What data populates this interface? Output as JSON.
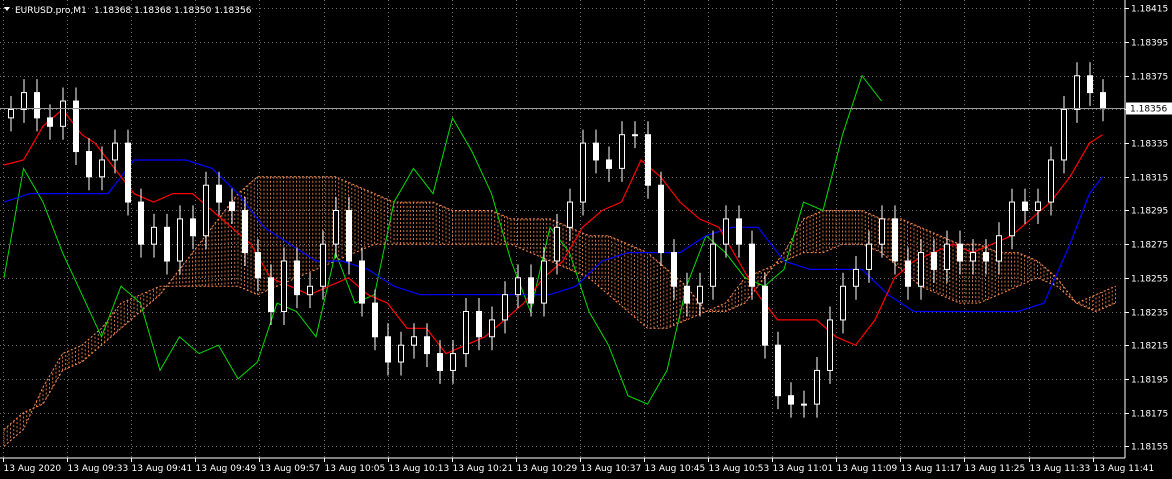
{
  "header": {
    "symbol": "EURUSD.pro,M1",
    "ohlc": "1.18368 1.18368 1.18350 1.18356"
  },
  "current_price_label": "1.18356",
  "colors": {
    "background": "#000000",
    "grid": "#c8c8c8",
    "candle_up": "#ffffff",
    "candle_down": "#ffffff",
    "wick": "#ffffff",
    "tenkan": "#ff0000",
    "kijun": "#0000ff",
    "chikou": "#00dd00",
    "cloud": "#ff8c50",
    "axis": "#ffffff",
    "price_line": "#9a9a9a"
  },
  "chart_data": {
    "type": "candlestick",
    "symbol": "EURUSD.pro",
    "timeframe": "M1",
    "ylim": [
      1.18148,
      1.1842
    ],
    "y_ticks": [
      "1.18415",
      "1.18395",
      "1.18375",
      "1.18355",
      "1.18335",
      "1.18315",
      "1.18295",
      "1.18275",
      "1.18255",
      "1.18235",
      "1.18215",
      "1.18195",
      "1.18175",
      "1.18155"
    ],
    "x_ticks": [
      "13 Aug 2020",
      "13 Aug 09:33",
      "13 Aug 09:41",
      "13 Aug 09:49",
      "13 Aug 09:57",
      "13 Aug 10:05",
      "13 Aug 10:13",
      "13 Aug 10:21",
      "13 Aug 10:29",
      "13 Aug 10:37",
      "13 Aug 10:45",
      "13 Aug 10:53",
      "13 Aug 11:01",
      "13 Aug 11:09",
      "13 Aug 11:17",
      "13 Aug 11:25",
      "13 Aug 11:33",
      "13 Aug 11:41"
    ],
    "close_points": [
      [
        1,
        1.18355
      ],
      [
        3,
        1.18365
      ],
      [
        5,
        1.1835
      ],
      [
        7,
        1.18345
      ],
      [
        9,
        1.1836
      ],
      [
        11,
        1.1833
      ],
      [
        13,
        1.18315
      ],
      [
        15,
        1.18325
      ],
      [
        17,
        1.18335
      ],
      [
        19,
        1.183
      ],
      [
        21,
        1.18275
      ],
      [
        23,
        1.18285
      ],
      [
        25,
        1.18265
      ],
      [
        27,
        1.1829
      ],
      [
        29,
        1.1828
      ],
      [
        31,
        1.1831
      ],
      [
        33,
        1.183
      ],
      [
        35,
        1.18295
      ],
      [
        37,
        1.1827
      ],
      [
        39,
        1.18255
      ],
      [
        41,
        1.18235
      ],
      [
        43,
        1.18265
      ],
      [
        45,
        1.18245
      ],
      [
        47,
        1.1825
      ],
      [
        49,
        1.18275
      ],
      [
        51,
        1.18295
      ],
      [
        53,
        1.18265
      ],
      [
        55,
        1.1824
      ],
      [
        57,
        1.1822
      ],
      [
        59,
        1.18205
      ],
      [
        61,
        1.18215
      ],
      [
        63,
        1.1822
      ],
      [
        65,
        1.1821
      ],
      [
        67,
        1.182
      ],
      [
        69,
        1.1821
      ],
      [
        71,
        1.18235
      ],
      [
        73,
        1.1822
      ],
      [
        75,
        1.1823
      ],
      [
        77,
        1.18245
      ],
      [
        79,
        1.18255
      ],
      [
        81,
        1.1824
      ],
      [
        83,
        1.18265
      ],
      [
        85,
        1.18285
      ],
      [
        87,
        1.183
      ],
      [
        89,
        1.18335
      ],
      [
        91,
        1.18325
      ],
      [
        93,
        1.1832
      ],
      [
        95,
        1.1834
      ],
      [
        97,
        1.1834
      ],
      [
        99,
        1.1831
      ],
      [
        101,
        1.1827
      ],
      [
        103,
        1.1825
      ],
      [
        105,
        1.1824
      ],
      [
        107,
        1.1825
      ],
      [
        109,
        1.18275
      ],
      [
        111,
        1.1829
      ],
      [
        113,
        1.18275
      ],
      [
        115,
        1.1825
      ],
      [
        117,
        1.18215
      ],
      [
        119,
        1.18185
      ],
      [
        121,
        1.1818
      ],
      [
        123,
        1.1818
      ],
      [
        125,
        1.182
      ],
      [
        127,
        1.1823
      ],
      [
        129,
        1.1825
      ],
      [
        131,
        1.1826
      ],
      [
        133,
        1.18275
      ],
      [
        135,
        1.1829
      ],
      [
        137,
        1.18265
      ],
      [
        139,
        1.1825
      ],
      [
        141,
        1.1827
      ],
      [
        143,
        1.1826
      ],
      [
        145,
        1.18275
      ],
      [
        147,
        1.18265
      ],
      [
        149,
        1.1827
      ],
      [
        151,
        1.18265
      ],
      [
        153,
        1.1828
      ],
      [
        155,
        1.183
      ],
      [
        157,
        1.18295
      ],
      [
        159,
        1.183
      ],
      [
        161,
        1.18325
      ],
      [
        163,
        1.18355
      ],
      [
        165,
        1.18375
      ],
      [
        167,
        1.18365
      ],
      [
        169,
        1.18356
      ]
    ],
    "series": [
      {
        "name": "tenkan_sen",
        "color": "#ff0000"
      },
      {
        "name": "kijun_sen",
        "color": "#0000ff"
      },
      {
        "name": "chikou_span",
        "color": "#00dd00"
      },
      {
        "name": "kumo_cloud",
        "color": "#ff8c50"
      }
    ],
    "tenkan": [
      [
        0,
        1.18322
      ],
      [
        3,
        1.18325
      ],
      [
        6,
        1.18345
      ],
      [
        9,
        1.18355
      ],
      [
        12,
        1.1834
      ],
      [
        14,
        1.18335
      ],
      [
        17,
        1.1832
      ],
      [
        20,
        1.18305
      ],
      [
        23,
        1.183
      ],
      [
        26,
        1.18305
      ],
      [
        29,
        1.18305
      ],
      [
        32,
        1.18295
      ],
      [
        35,
        1.18285
      ],
      [
        38,
        1.18275
      ],
      [
        41,
        1.18255
      ],
      [
        44,
        1.1825
      ],
      [
        47,
        1.18245
      ],
      [
        50,
        1.1825
      ],
      [
        53,
        1.18255
      ],
      [
        56,
        1.18245
      ],
      [
        59,
        1.1824
      ],
      [
        62,
        1.18225
      ],
      [
        65,
        1.18225
      ],
      [
        68,
        1.1821
      ],
      [
        71,
        1.18215
      ],
      [
        74,
        1.1822
      ],
      [
        77,
        1.1823
      ],
      [
        80,
        1.1824
      ],
      [
        83,
        1.18255
      ],
      [
        86,
        1.18265
      ],
      [
        89,
        1.18285
      ],
      [
        92,
        1.18295
      ],
      [
        95,
        1.183
      ],
      [
        98,
        1.18325
      ],
      [
        101,
        1.18315
      ],
      [
        104,
        1.183
      ],
      [
        107,
        1.1829
      ],
      [
        110,
        1.18285
      ],
      [
        113,
        1.18265
      ],
      [
        116,
        1.18245
      ],
      [
        119,
        1.1823
      ],
      [
        122,
        1.1823
      ],
      [
        125,
        1.1823
      ],
      [
        128,
        1.1822
      ],
      [
        131,
        1.18215
      ],
      [
        134,
        1.1823
      ],
      [
        137,
        1.18255
      ],
      [
        140,
        1.18265
      ],
      [
        143,
        1.1827
      ],
      [
        146,
        1.18275
      ],
      [
        149,
        1.1827
      ],
      [
        152,
        1.18275
      ],
      [
        155,
        1.1828
      ],
      [
        158,
        1.1829
      ],
      [
        161,
        1.183
      ],
      [
        164,
        1.18315
      ],
      [
        167,
        1.18335
      ],
      [
        169,
        1.1834
      ]
    ],
    "kijun": [
      [
        0,
        1.183
      ],
      [
        4,
        1.18305
      ],
      [
        8,
        1.18305
      ],
      [
        12,
        1.18305
      ],
      [
        16,
        1.18305
      ],
      [
        20,
        1.18325
      ],
      [
        24,
        1.18325
      ],
      [
        28,
        1.18325
      ],
      [
        32,
        1.1832
      ],
      [
        36,
        1.18305
      ],
      [
        40,
        1.18285
      ],
      [
        44,
        1.18275
      ],
      [
        48,
        1.18265
      ],
      [
        52,
        1.18265
      ],
      [
        56,
        1.1826
      ],
      [
        60,
        1.1825
      ],
      [
        64,
        1.18245
      ],
      [
        68,
        1.18245
      ],
      [
        72,
        1.18245
      ],
      [
        76,
        1.18245
      ],
      [
        80,
        1.18245
      ],
      [
        84,
        1.18245
      ],
      [
        88,
        1.1825
      ],
      [
        92,
        1.18265
      ],
      [
        96,
        1.1827
      ],
      [
        100,
        1.1827
      ],
      [
        104,
        1.1827
      ],
      [
        108,
        1.1828
      ],
      [
        112,
        1.18285
      ],
      [
        116,
        1.18285
      ],
      [
        120,
        1.18265
      ],
      [
        124,
        1.1826
      ],
      [
        128,
        1.1826
      ],
      [
        132,
        1.1826
      ],
      [
        136,
        1.18245
      ],
      [
        140,
        1.18235
      ],
      [
        144,
        1.18235
      ],
      [
        148,
        1.18235
      ],
      [
        152,
        1.18235
      ],
      [
        156,
        1.18235
      ],
      [
        160,
        1.1824
      ],
      [
        164,
        1.18275
      ],
      [
        167,
        1.18305
      ],
      [
        169,
        1.18315
      ]
    ],
    "chikou": [
      [
        0,
        1.18255
      ],
      [
        3,
        1.1832
      ],
      [
        6,
        1.183
      ],
      [
        9,
        1.1827
      ],
      [
        12,
        1.18245
      ],
      [
        15,
        1.1822
      ],
      [
        18,
        1.1825
      ],
      [
        21,
        1.1824
      ],
      [
        24,
        1.182
      ],
      [
        27,
        1.1822
      ],
      [
        30,
        1.1821
      ],
      [
        33,
        1.18215
      ],
      [
        36,
        1.18195
      ],
      [
        39,
        1.18205
      ],
      [
        42,
        1.1824
      ],
      [
        45,
        1.18235
      ],
      [
        48,
        1.1822
      ],
      [
        51,
        1.1827
      ],
      [
        54,
        1.1824
      ],
      [
        57,
        1.18245
      ],
      [
        60,
        1.183
      ],
      [
        63,
        1.1832
      ],
      [
        66,
        1.18305
      ],
      [
        69,
        1.1835
      ],
      [
        72,
        1.1833
      ],
      [
        75,
        1.18305
      ],
      [
        78,
        1.18265
      ],
      [
        81,
        1.18235
      ],
      [
        84,
        1.18285
      ],
      [
        87,
        1.1827
      ],
      [
        90,
        1.18235
      ],
      [
        93,
        1.18215
      ],
      [
        96,
        1.18185
      ],
      [
        99,
        1.1818
      ],
      [
        102,
        1.182
      ],
      [
        105,
        1.1825
      ],
      [
        108,
        1.1828
      ],
      [
        111,
        1.1827
      ],
      [
        114,
        1.18255
      ],
      [
        117,
        1.1825
      ],
      [
        120,
        1.1826
      ],
      [
        123,
        1.183
      ],
      [
        126,
        1.18295
      ],
      [
        129,
        1.1834
      ],
      [
        132,
        1.18375
      ],
      [
        135,
        1.1836
      ]
    ],
    "senkou_a": [
      [
        0,
        1.18165
      ],
      [
        3,
        1.18175
      ],
      [
        6,
        1.1818
      ],
      [
        9,
        1.182
      ],
      [
        12,
        1.18205
      ],
      [
        15,
        1.18215
      ],
      [
        18,
        1.18225
      ],
      [
        21,
        1.18235
      ],
      [
        24,
        1.18245
      ],
      [
        27,
        1.1826
      ],
      [
        30,
        1.18275
      ],
      [
        33,
        1.1829
      ],
      [
        36,
        1.18305
      ],
      [
        39,
        1.18315
      ],
      [
        42,
        1.18315
      ],
      [
        45,
        1.18315
      ],
      [
        48,
        1.18315
      ],
      [
        51,
        1.18315
      ],
      [
        54,
        1.1831
      ],
      [
        57,
        1.18305
      ],
      [
        60,
        1.183
      ],
      [
        63,
        1.183
      ],
      [
        66,
        1.183
      ],
      [
        69,
        1.18295
      ],
      [
        72,
        1.18295
      ],
      [
        75,
        1.18295
      ],
      [
        78,
        1.1829
      ],
      [
        81,
        1.1829
      ],
      [
        84,
        1.1829
      ],
      [
        87,
        1.18285
      ],
      [
        90,
        1.1828
      ],
      [
        93,
        1.1828
      ],
      [
        96,
        1.18275
      ],
      [
        99,
        1.1827
      ],
      [
        102,
        1.1826
      ],
      [
        105,
        1.1825
      ],
      [
        108,
        1.18235
      ],
      [
        111,
        1.18235
      ],
      [
        114,
        1.1824
      ],
      [
        117,
        1.18255
      ],
      [
        120,
        1.1827
      ],
      [
        123,
        1.1829
      ],
      [
        126,
        1.18295
      ],
      [
        129,
        1.18295
      ],
      [
        132,
        1.18295
      ],
      [
        135,
        1.1829
      ],
      [
        138,
        1.1829
      ],
      [
        141,
        1.18285
      ],
      [
        144,
        1.1828
      ],
      [
        147,
        1.18275
      ],
      [
        150,
        1.18275
      ],
      [
        153,
        1.1827
      ],
      [
        156,
        1.1827
      ],
      [
        159,
        1.18265
      ],
      [
        162,
        1.18255
      ],
      [
        165,
        1.1824
      ],
      [
        168,
        1.18235
      ],
      [
        171,
        1.1824
      ]
    ],
    "senkou_b": [
      [
        0,
        1.18155
      ],
      [
        3,
        1.18165
      ],
      [
        6,
        1.1819
      ],
      [
        9,
        1.1821
      ],
      [
        12,
        1.18215
      ],
      [
        15,
        1.18225
      ],
      [
        18,
        1.1824
      ],
      [
        21,
        1.18245
      ],
      [
        24,
        1.1825
      ],
      [
        27,
        1.1825
      ],
      [
        30,
        1.1825
      ],
      [
        33,
        1.1825
      ],
      [
        36,
        1.1825
      ],
      [
        39,
        1.18245
      ],
      [
        42,
        1.1825
      ],
      [
        45,
        1.18255
      ],
      [
        48,
        1.1826
      ],
      [
        51,
        1.18265
      ],
      [
        54,
        1.1827
      ],
      [
        57,
        1.18275
      ],
      [
        60,
        1.18275
      ],
      [
        63,
        1.18275
      ],
      [
        66,
        1.18275
      ],
      [
        69,
        1.18275
      ],
      [
        72,
        1.18275
      ],
      [
        75,
        1.18275
      ],
      [
        78,
        1.18275
      ],
      [
        81,
        1.1827
      ],
      [
        84,
        1.18265
      ],
      [
        87,
        1.1826
      ],
      [
        90,
        1.18255
      ],
      [
        93,
        1.18245
      ],
      [
        96,
        1.18235
      ],
      [
        99,
        1.18225
      ],
      [
        102,
        1.18225
      ],
      [
        105,
        1.1823
      ],
      [
        108,
        1.18235
      ],
      [
        111,
        1.1824
      ],
      [
        114,
        1.18255
      ],
      [
        117,
        1.1826
      ],
      [
        120,
        1.18265
      ],
      [
        123,
        1.1827
      ],
      [
        126,
        1.1827
      ],
      [
        129,
        1.18275
      ],
      [
        132,
        1.18275
      ],
      [
        135,
        1.1827
      ],
      [
        138,
        1.1826
      ],
      [
        141,
        1.1825
      ],
      [
        144,
        1.18245
      ],
      [
        147,
        1.1824
      ],
      [
        150,
        1.1824
      ],
      [
        153,
        1.18245
      ],
      [
        156,
        1.1825
      ],
      [
        159,
        1.18255
      ],
      [
        162,
        1.1825
      ],
      [
        165,
        1.1824
      ],
      [
        168,
        1.18245
      ],
      [
        171,
        1.1825
      ]
    ]
  }
}
